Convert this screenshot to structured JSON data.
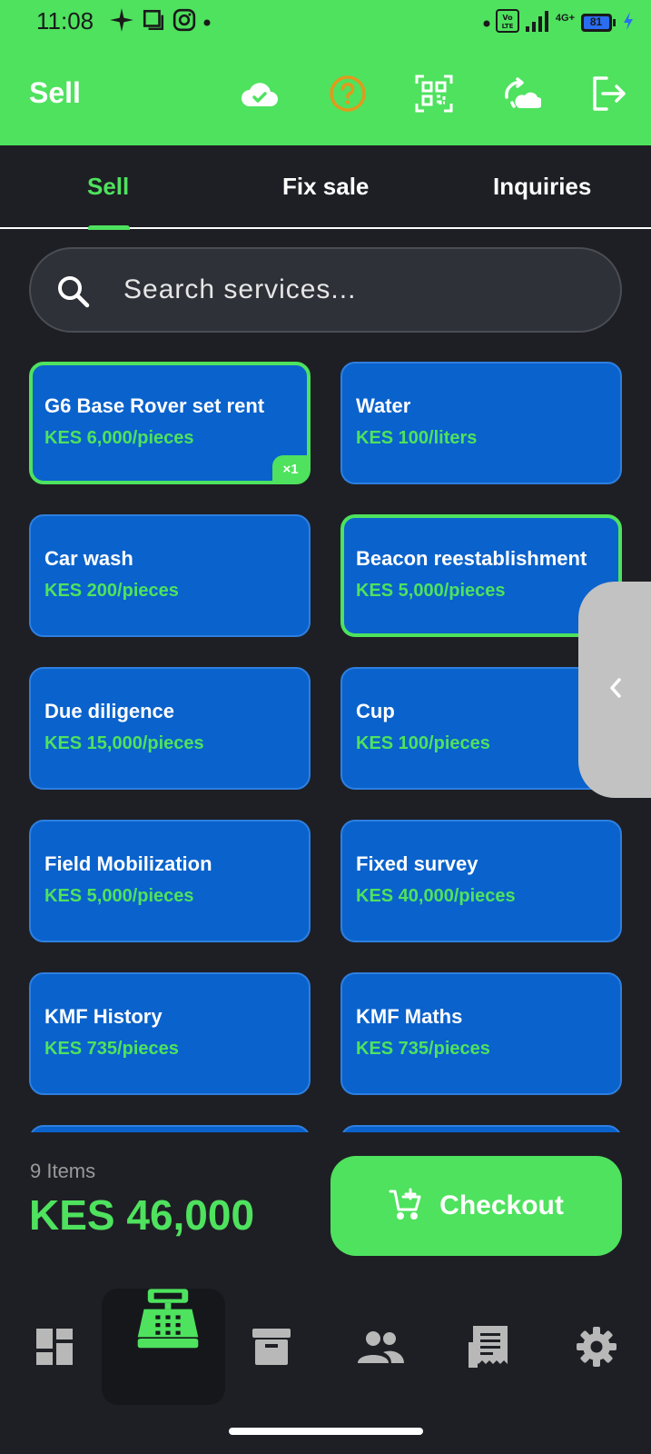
{
  "status_bar": {
    "time": "11:08",
    "network": "4G+",
    "battery": "81"
  },
  "app_bar": {
    "title": "Sell",
    "icons": [
      "cloud-check-icon",
      "help-icon",
      "qr-scan-icon",
      "sync-cloud-icon",
      "logout-icon"
    ]
  },
  "tabs": [
    {
      "label": "Sell",
      "active": true
    },
    {
      "label": "Fix sale",
      "active": false
    },
    {
      "label": "Inquiries",
      "active": false
    }
  ],
  "search": {
    "placeholder": "Search services..."
  },
  "services": [
    {
      "name": "G6 Base Rover set rent",
      "price": "KES 6,000/pieces",
      "selected": true,
      "qty": "×1"
    },
    {
      "name": "Water",
      "price": "KES 100/liters",
      "selected": false
    },
    {
      "name": "Car wash",
      "price": "KES 200/pieces",
      "selected": false
    },
    {
      "name": "Beacon reestablishment",
      "price": "KES 5,000/pieces",
      "selected": true
    },
    {
      "name": "Due diligence",
      "price": "KES 15,000/pieces",
      "selected": false
    },
    {
      "name": "Cup",
      "price": "KES 100/pieces",
      "selected": false
    },
    {
      "name": "Field Mobilization",
      "price": "KES 5,000/pieces",
      "selected": false
    },
    {
      "name": "Fixed survey",
      "price": "KES 40,000/pieces",
      "selected": false
    },
    {
      "name": "KMF History",
      "price": "KES 735/pieces",
      "selected": false
    },
    {
      "name": "KMF Maths",
      "price": "KES 735/pieces",
      "selected": false
    }
  ],
  "cart": {
    "items_count": "9 Items",
    "total": "KES 46,000",
    "checkout_label": "Checkout"
  },
  "bottom_nav": [
    {
      "icon": "dashboard-icon",
      "active": false
    },
    {
      "icon": "cash-register-icon",
      "active": true
    },
    {
      "icon": "archive-icon",
      "active": false
    },
    {
      "icon": "people-icon",
      "active": false
    },
    {
      "icon": "receipt-icon",
      "active": false
    },
    {
      "icon": "settings-icon",
      "active": false
    }
  ],
  "colors": {
    "accent": "#4ee25e",
    "card": "#0a62cc",
    "background": "#1e1f24"
  }
}
